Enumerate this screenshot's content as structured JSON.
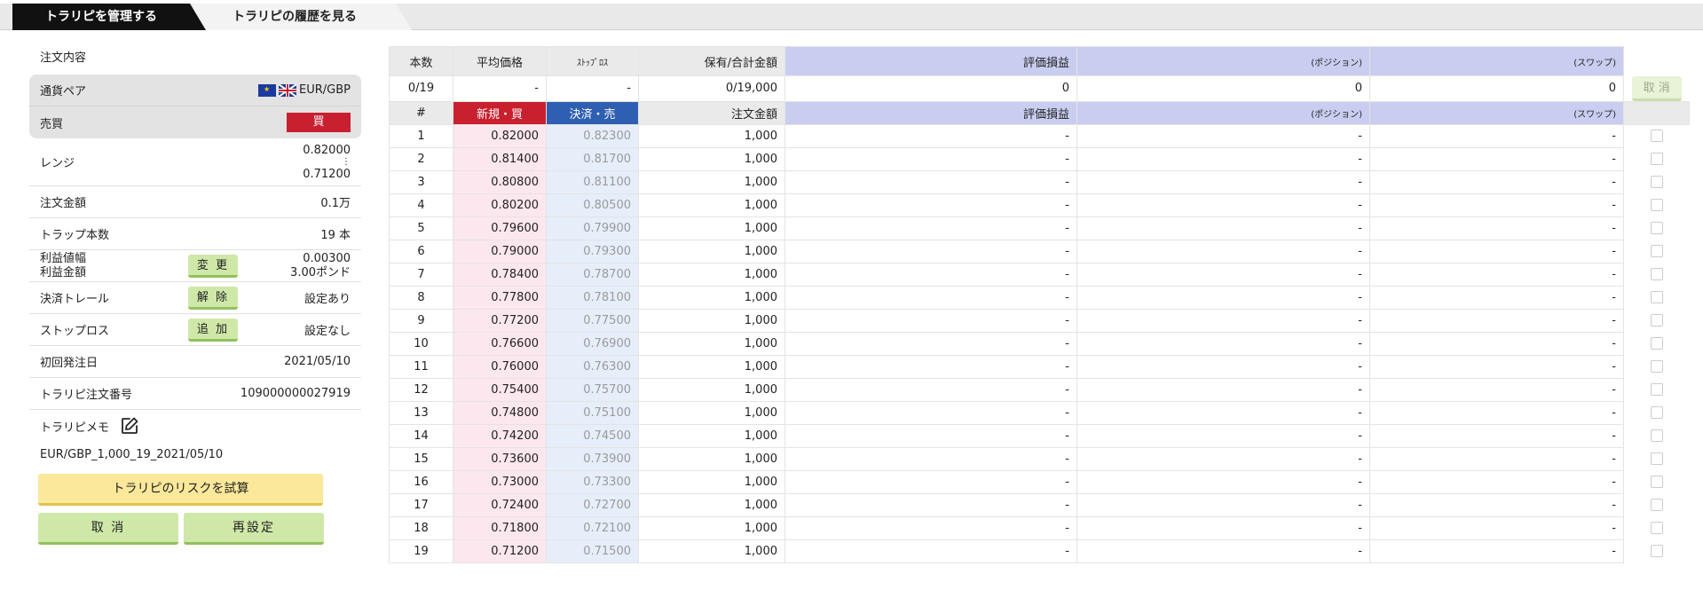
{
  "tabs": [
    {
      "label": "トラリピを管理する",
      "active": true
    },
    {
      "label": "トラリピの履歴を見る",
      "active": false
    }
  ],
  "left": {
    "title": "注文内容",
    "pair_label": "通貨ペア",
    "pair_value": "EUR/GBP",
    "side_label": "売買",
    "side_value": "買",
    "range_label": "レンジ",
    "range_high": "0.82000",
    "range_sep": "⋮",
    "range_low": "0.71200",
    "amount_label": "注文金額",
    "amount_value": "0.1万",
    "traps_label": "トラップ本数",
    "traps_value": "19 本",
    "profit_width_label": "利益値幅",
    "profit_amount_label": "利益金額",
    "profit_width_value": "0.00300",
    "profit_amount_value": "3.00ポンド",
    "change_button": "変 更",
    "trail_label": "決済トレール",
    "trail_button": "解 除",
    "trail_value": "設定あり",
    "stop_label": "ストップロス",
    "stop_button": "追 加",
    "stop_value": "設定なし",
    "first_date_label": "初回発注日",
    "first_date_value": "2021/05/10",
    "order_no_label": "トラリピ注文番号",
    "order_no_value": "109000000027919",
    "memo_label": "トラリピメモ",
    "memo_text": "EUR/GBP_1,000_19_2021/05/10",
    "risk_button": "トラリピのリスクを試算",
    "cancel_button": "取 消",
    "reset_button": "再設定"
  },
  "summary": {
    "headers": [
      "本数",
      "平均価格",
      "ｽﾄｯﾌﾟﾛｽ",
      "保有/合計金額",
      "評価損益",
      "(ポジション)",
      "(スワップ)"
    ],
    "values": [
      "0/19",
      "-",
      "-",
      "0/19,000",
      "0",
      "0",
      "0"
    ],
    "cancel_label": "取 消"
  },
  "orders": {
    "headers": [
      "#",
      "新規・買",
      "決済・売",
      "注文金額",
      "評価損益",
      "(ポジション)",
      "(スワップ)"
    ],
    "rows": [
      {
        "n": "1",
        "new": "0.82000",
        "settle": "0.82300",
        "amount": "1,000",
        "pl": "-",
        "pos": "-",
        "swap": "-"
      },
      {
        "n": "2",
        "new": "0.81400",
        "settle": "0.81700",
        "amount": "1,000",
        "pl": "-",
        "pos": "-",
        "swap": "-"
      },
      {
        "n": "3",
        "new": "0.80800",
        "settle": "0.81100",
        "amount": "1,000",
        "pl": "-",
        "pos": "-",
        "swap": "-"
      },
      {
        "n": "4",
        "new": "0.80200",
        "settle": "0.80500",
        "amount": "1,000",
        "pl": "-",
        "pos": "-",
        "swap": "-"
      },
      {
        "n": "5",
        "new": "0.79600",
        "settle": "0.79900",
        "amount": "1,000",
        "pl": "-",
        "pos": "-",
        "swap": "-"
      },
      {
        "n": "6",
        "new": "0.79000",
        "settle": "0.79300",
        "amount": "1,000",
        "pl": "-",
        "pos": "-",
        "swap": "-"
      },
      {
        "n": "7",
        "new": "0.78400",
        "settle": "0.78700",
        "amount": "1,000",
        "pl": "-",
        "pos": "-",
        "swap": "-"
      },
      {
        "n": "8",
        "new": "0.77800",
        "settle": "0.78100",
        "amount": "1,000",
        "pl": "-",
        "pos": "-",
        "swap": "-"
      },
      {
        "n": "9",
        "new": "0.77200",
        "settle": "0.77500",
        "amount": "1,000",
        "pl": "-",
        "pos": "-",
        "swap": "-"
      },
      {
        "n": "10",
        "new": "0.76600",
        "settle": "0.76900",
        "amount": "1,000",
        "pl": "-",
        "pos": "-",
        "swap": "-"
      },
      {
        "n": "11",
        "new": "0.76000",
        "settle": "0.76300",
        "amount": "1,000",
        "pl": "-",
        "pos": "-",
        "swap": "-"
      },
      {
        "n": "12",
        "new": "0.75400",
        "settle": "0.75700",
        "amount": "1,000",
        "pl": "-",
        "pos": "-",
        "swap": "-"
      },
      {
        "n": "13",
        "new": "0.74800",
        "settle": "0.75100",
        "amount": "1,000",
        "pl": "-",
        "pos": "-",
        "swap": "-"
      },
      {
        "n": "14",
        "new": "0.74200",
        "settle": "0.74500",
        "amount": "1,000",
        "pl": "-",
        "pos": "-",
        "swap": "-"
      },
      {
        "n": "15",
        "new": "0.73600",
        "settle": "0.73900",
        "amount": "1,000",
        "pl": "-",
        "pos": "-",
        "swap": "-"
      },
      {
        "n": "16",
        "new": "0.73000",
        "settle": "0.73300",
        "amount": "1,000",
        "pl": "-",
        "pos": "-",
        "swap": "-"
      },
      {
        "n": "17",
        "new": "0.72400",
        "settle": "0.72700",
        "amount": "1,000",
        "pl": "-",
        "pos": "-",
        "swap": "-"
      },
      {
        "n": "18",
        "new": "0.71800",
        "settle": "0.72100",
        "amount": "1,000",
        "pl": "-",
        "pos": "-",
        "swap": "-"
      },
      {
        "n": "19",
        "new": "0.71200",
        "settle": "0.71500",
        "amount": "1,000",
        "pl": "-",
        "pos": "-",
        "swap": "-"
      }
    ]
  },
  "colors": {
    "buy": "#c8202f",
    "settle": "#2f5fb0",
    "pl_header": "#c9cef0",
    "green_button": "#cfe8a8",
    "yellow_button": "#fbe89a"
  },
  "icons": {
    "edit": "edit-icon",
    "eu_flag": "eu-flag-icon",
    "uk_flag": "uk-flag-icon"
  }
}
